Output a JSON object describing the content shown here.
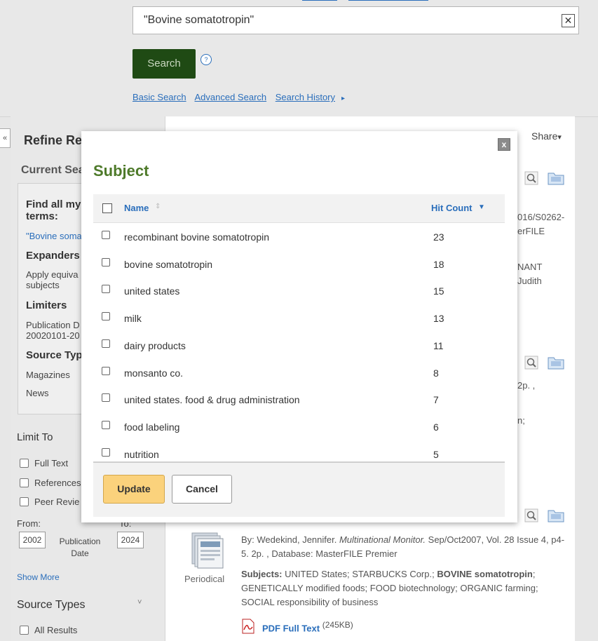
{
  "search": {
    "query": "\"Bovine somatotropin\"",
    "clear_icon": "close-icon",
    "button_label": "Search",
    "help_label": "?",
    "links": [
      "Basic Search",
      "Advanced Search",
      "Search History"
    ],
    "history_arrow": "▸"
  },
  "sidebar": {
    "collapse_label": "«",
    "refine_title": "Refine Re",
    "current_search_label": "Current Sea",
    "current": {
      "find_all_head": "Find all my",
      "find_all_head2": "terms:",
      "find_all_value": "\"Bovine soma",
      "expanders_head": "Expanders",
      "expanders_value1": "Apply equiva",
      "expanders_value2": "subjects",
      "limiters_head": "Limiters",
      "limiters_value1": "Publication D",
      "limiters_value2": "20020101-20",
      "source_head": "Source Typ",
      "source_value1": "Magazines",
      "source_value2": "News"
    },
    "limit_to_title": "Limit To",
    "limit_to_items": [
      "Full Text",
      "References",
      "Peer Revie"
    ],
    "from_label": "From:",
    "to_label": "To:",
    "from_year": "2002",
    "to_year": "2024",
    "pub_date_label": "Publication Date",
    "show_more": "Show More",
    "source_types_title": "Source Types",
    "source_types_chevron": "˅",
    "all_results": "All Results"
  },
  "results": {
    "share_label": "Share",
    "share_arrow": "▾",
    "r1_frag1": "016/S0262-",
    "r1_frag2": "erFILE",
    "r1_frag3": "NANT",
    "r1_frag4": "Judith",
    "r2_frag1": "2p. ,",
    "r2_frag2": "n;",
    "r3": {
      "type_label": "Periodical",
      "byline_prefix": "By: Wedekind, Jennifer. ",
      "byline_source": "Multinational Monitor.",
      "byline_rest": " Sep/Oct2007, Vol. 28 Issue 4, p4-5. 2p. , Database: MasterFILE Premier",
      "subjects_label": "Subjects:",
      "subjects_a": " UNITED States; STARBUCKS Corp.; ",
      "subjects_bold": "BOVINE somatotropin",
      "subjects_b": "; GENETICALLY modified foods; FOOD biotechnology; ORGANIC farming; SOCIAL responsibility of business",
      "pdf_label": "PDF Full Text",
      "pdf_size": "(245KB)"
    }
  },
  "modal": {
    "title": "Subject",
    "close_label": "x",
    "col_name": "Name",
    "col_name_sort": "⇕",
    "col_hits": "Hit Count",
    "col_hits_sort": "▼",
    "rows": [
      {
        "name": "recombinant bovine somatotropin",
        "count": "23"
      },
      {
        "name": "bovine somatotropin",
        "count": "18"
      },
      {
        "name": "united states",
        "count": "15"
      },
      {
        "name": "milk",
        "count": "13"
      },
      {
        "name": "dairy products",
        "count": "11"
      },
      {
        "name": "monsanto co.",
        "count": "8"
      },
      {
        "name": "united states. food & drug administration",
        "count": "7"
      },
      {
        "name": "food labeling",
        "count": "6"
      },
      {
        "name": "nutrition",
        "count": "5"
      }
    ],
    "update_label": "Update",
    "cancel_label": "Cancel"
  }
}
